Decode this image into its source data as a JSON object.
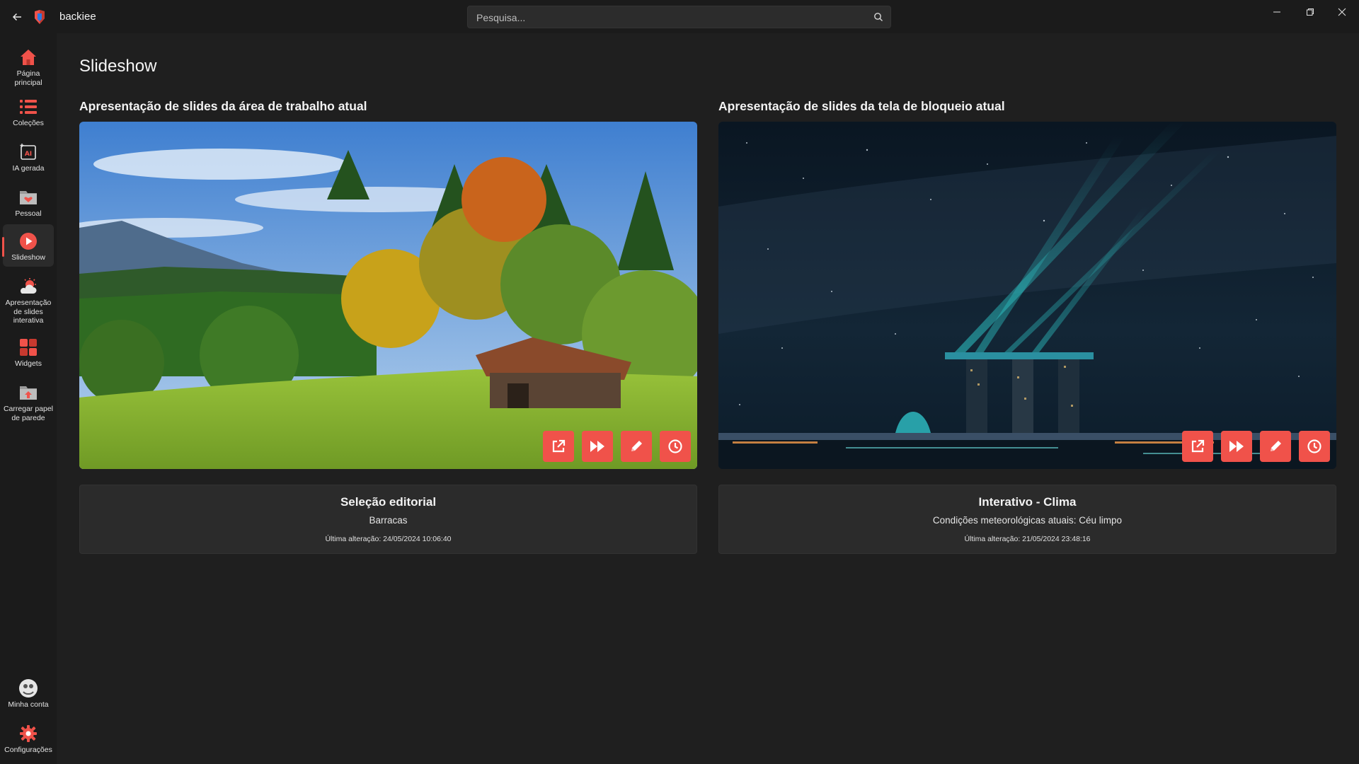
{
  "app": {
    "name": "backiee"
  },
  "search": {
    "placeholder": "Pesquisa..."
  },
  "sidebar": {
    "items": [
      {
        "label": "Página principal",
        "icon": "home-icon"
      },
      {
        "label": "Coleções",
        "icon": "list-icon"
      },
      {
        "label": "IA gerada",
        "icon": "ai-icon"
      },
      {
        "label": "Pessoal",
        "icon": "folder-heart-icon"
      },
      {
        "label": "Slideshow",
        "icon": "play-icon",
        "active": true
      },
      {
        "label": "Apresentação de slides interativa",
        "icon": "weather-icon"
      },
      {
        "label": "Widgets",
        "icon": "widgets-icon"
      },
      {
        "label": "Carregar papel de parede",
        "icon": "upload-folder-icon"
      }
    ],
    "bottom": [
      {
        "label": "Minha conta",
        "icon": "avatar"
      },
      {
        "label": "Configurações",
        "icon": "gear-icon"
      }
    ]
  },
  "page": {
    "title": "Slideshow"
  },
  "slideshows": [
    {
      "section_title": "Apresentação de slides da área de trabalho atual",
      "card_title": "Seleção editorial",
      "card_subtitle": "Barracas",
      "last_changed": "Última alteração: 24/05/2024 10:06:40"
    },
    {
      "section_title": "Apresentação de slides da tela de bloqueio atual",
      "card_title": "Interativo - Clima",
      "card_subtitle": "Condições meteorológicas atuais: Céu limpo",
      "last_changed": "Última alteração: 21/05/2024 23:48:16"
    }
  ],
  "colors": {
    "accent": "#f0524a",
    "background": "#1f1f1f",
    "sidebar": "#1b1b1b",
    "card": "#2b2b2b"
  }
}
